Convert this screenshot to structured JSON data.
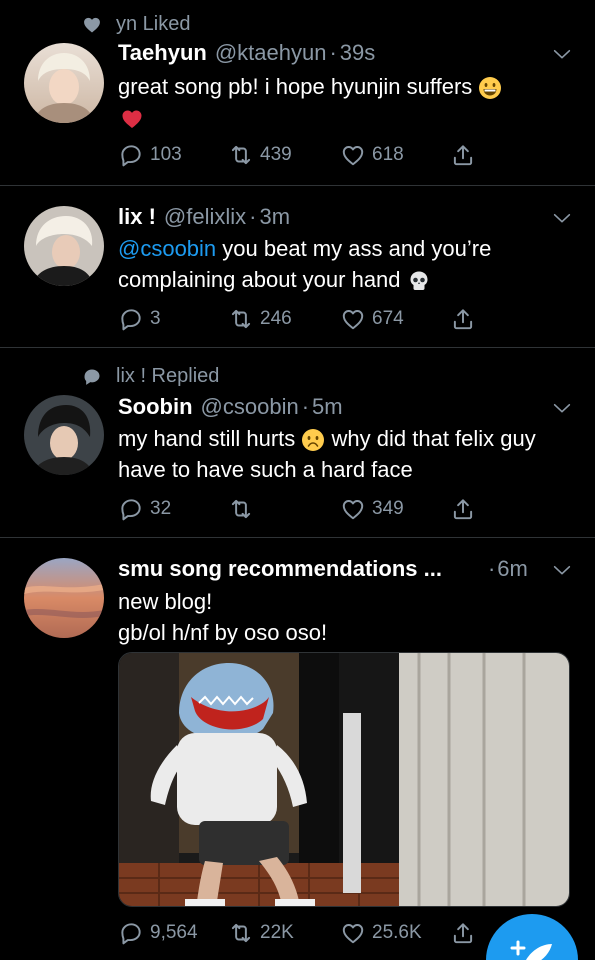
{
  "tweets": [
    {
      "context": "yn Liked",
      "name": "Taehyun",
      "handle": "@ktaehyun",
      "sep": "·",
      "time": "39s",
      "text": "great song pb! i hope hyunjin suffers",
      "emoji_1": "grinning-face",
      "emoji_2": "red-heart",
      "replies": "103",
      "retweets": "439",
      "likes": "618"
    },
    {
      "name": "lix !",
      "handle": "@felixlix",
      "sep": "·",
      "time": "3m",
      "mention": "@csoobin",
      "text_a": " you beat my ass and you’re complaining about your hand",
      "emoji_1": "skull",
      "replies": "3",
      "retweets": "246",
      "likes": "674"
    },
    {
      "context": "lix ! Replied",
      "name": "Soobin",
      "handle": "@csoobin",
      "sep": "·",
      "time": "5m",
      "text_a": "my hand still hurts",
      "emoji_1": "frowning-face",
      "text_b": " why did that felix guy have to have such a hard face",
      "replies": "32",
      "retweets": "",
      "likes": "349"
    },
    {
      "name": "smu song recommendations ...",
      "sep": "·",
      "time": "6m",
      "line_1": "new blog!",
      "line_2": "gb/ol h/nf by oso oso!",
      "replies": "9,564",
      "retweets": "22K",
      "likes": "25.6K"
    }
  ],
  "colors": {
    "background": "#000000",
    "text": "#ffffff",
    "muted": "#8b98a5",
    "accent": "#1d9bf0",
    "divider": "#2f3336"
  },
  "icons": [
    "heart-icon",
    "speech-bubble-icon",
    "reply-icon",
    "retweet-icon",
    "like-icon",
    "share-icon",
    "chevron-down-icon",
    "compose-icon"
  ]
}
